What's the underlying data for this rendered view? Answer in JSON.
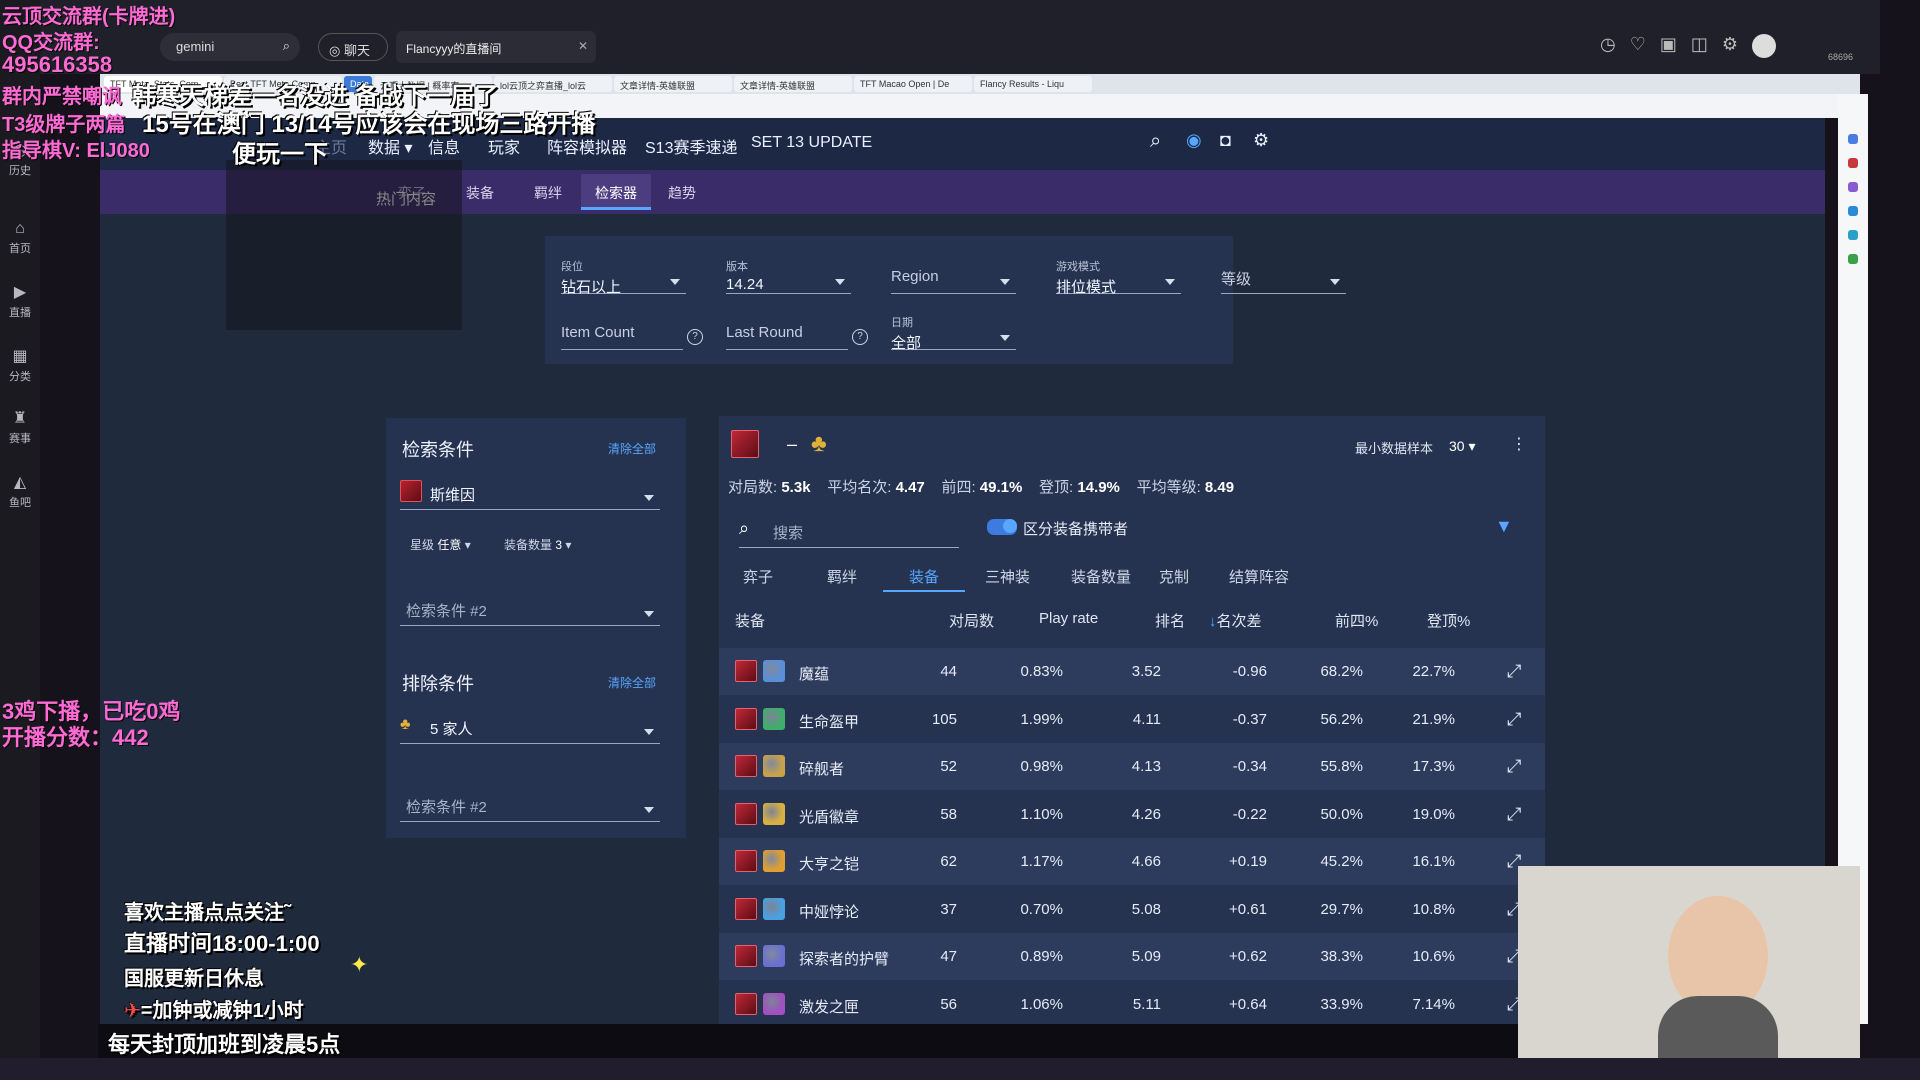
{
  "stream": {
    "search_value": "gemini",
    "chat_label": "聊天",
    "room_title": "Flancyyy的直播间",
    "left_items": [
      "历史",
      "首页",
      "直播",
      "分类",
      "赛事",
      "鱼吧"
    ],
    "viewer_count": "68696"
  },
  "browser_tabs": [
    "TFT Meta, Stats, Com",
    "Best TFT Meta Comp",
    "Data",
    "云顶大数据 | 概率率",
    "lol云顶之弈直播_lol云",
    "文章详情-英雄联盟",
    "文章详情-英雄联盟",
    "TFT Macao Open | De",
    "Flancy Results - Liqu"
  ],
  "site": {
    "nav": [
      "数据",
      "信息",
      "玩家",
      "阵容模拟器",
      "S13赛季速递",
      "SET 13 UPDATE"
    ],
    "nav_faded": [
      "主页"
    ],
    "subnav": [
      "弈子",
      "装备",
      "羁绊",
      "检索器",
      "趋势"
    ],
    "subnav_active": "检索器",
    "filters": {
      "rank": {
        "label": "段位",
        "value": "钻石以上"
      },
      "version": {
        "label": "版本",
        "value": "14.24"
      },
      "region": {
        "value": "Region"
      },
      "mode": {
        "label": "游戏模式",
        "value": "排位模式"
      },
      "level": {
        "value": "等级"
      },
      "item_count": {
        "value": "Item Count"
      },
      "last_round": {
        "value": "Last Round"
      },
      "date": {
        "label": "日期",
        "value": "全部"
      }
    },
    "conditions": {
      "title": "检索条件",
      "clear": "清除全部",
      "champion": "斯维因",
      "star_label": "星级",
      "star_value": "任意",
      "item_label": "装备数量",
      "item_value": "3",
      "cond2": "检索条件 #2"
    },
    "exclusions": {
      "title": "排除条件",
      "clear": "清除全部",
      "trait": "5 家人",
      "cond2": "检索条件 #2"
    },
    "results": {
      "dash": "–",
      "min_sample_label": "最小数据样本",
      "min_sample_value": "30",
      "stats": {
        "games_label": "对局数:",
        "games": "5.3k",
        "avg_place_label": "平均名次:",
        "avg_place": "4.47",
        "top4_label": "前四:",
        "top4": "49.1%",
        "win_label": "登顶:",
        "win": "14.9%",
        "avg_level_label": "平均等级:",
        "avg_level": "8.49"
      },
      "search_placeholder": "搜索",
      "toggle_label": "区分装备携带者",
      "tabs": [
        "弈子",
        "羁绊",
        "装备",
        "三神装",
        "装备数量",
        "克制",
        "结算阵容"
      ],
      "active_tab": "装备",
      "columns": [
        "装备",
        "对局数",
        "Play rate",
        "排名",
        "名次差",
        "前四%",
        "登顶%"
      ],
      "sort_arrow": "↓",
      "rows": [
        {
          "name": "魔蕴",
          "games": "44",
          "play": "0.83%",
          "place": "3.52",
          "delta": "-0.96",
          "top4": "68.2%",
          "win": "22.7%",
          "color": "#5a8fd8"
        },
        {
          "name": "生命盔甲",
          "games": "105",
          "play": "1.99%",
          "place": "4.11",
          "delta": "-0.37",
          "top4": "56.2%",
          "win": "21.9%",
          "color": "#3fae6a"
        },
        {
          "name": "碎舰者",
          "games": "52",
          "play": "0.98%",
          "place": "4.13",
          "delta": "-0.34",
          "top4": "55.8%",
          "win": "17.3%",
          "color": "#c8a24a"
        },
        {
          "name": "光盾徽章",
          "games": "58",
          "play": "1.10%",
          "place": "4.26",
          "delta": "-0.22",
          "top4": "50.0%",
          "win": "19.0%",
          "color": "#d8b040"
        },
        {
          "name": "大亨之铠",
          "games": "62",
          "play": "1.17%",
          "place": "4.66",
          "delta": "+0.19",
          "top4": "45.2%",
          "win": "16.1%",
          "color": "#e0a030"
        },
        {
          "name": "中娅悖论",
          "games": "37",
          "play": "0.70%",
          "place": "5.08",
          "delta": "+0.61",
          "top4": "29.7%",
          "win": "10.8%",
          "color": "#4aa0e0"
        },
        {
          "name": "探索者的护臂",
          "games": "47",
          "play": "0.89%",
          "place": "5.09",
          "delta": "+0.62",
          "top4": "38.3%",
          "win": "10.6%",
          "color": "#6a70d0"
        },
        {
          "name": "激发之匣",
          "games": "56",
          "play": "1.06%",
          "place": "5.11",
          "delta": "+0.64",
          "top4": "33.9%",
          "win": "7.14%",
          "color": "#a050c0"
        }
      ]
    }
  },
  "overlays": {
    "top_left": [
      "云顶交流群(卡牌进)",
      "QQ交流群:",
      "495616358",
      "群内严禁嘲讽",
      "T3级牌子两篇",
      "指导棋V: ElJ080"
    ],
    "headline1": "韩寒天梯差一名没进 备战下一届了",
    "headline2": "15号在澳门 13/14号应该会在现场三路开播",
    "headline3": "便玩一下",
    "red_mid1": "3鸡下播，已吃0鸡",
    "red_mid2": "开播分数：442",
    "promo": [
      "喜欢主播点点关注˜",
      "直播时间18:00-1:00",
      "国服更新日休息",
      "=加钟或减钟1小时"
    ],
    "ticker": "每天封顶加班到凌晨5点",
    "chat_hot": "热门内容"
  },
  "colors": {
    "accent": "#57a6ff",
    "nav_bg": "#1c2844",
    "subnav_bg": "#3a2c68",
    "panel_bg": "#263350",
    "overlay_pink": "#ff6ad5"
  }
}
